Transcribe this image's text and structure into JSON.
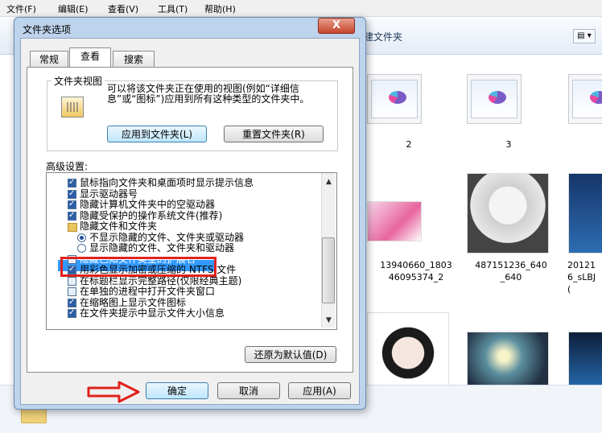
{
  "explorer": {
    "menu": [
      "文件(F)",
      "编辑(E)",
      "查看(V)",
      "工具(T)",
      "帮助(H)"
    ],
    "folder_title": "建文件夹",
    "view_toggle": "▤ ▾",
    "thumbnails": [
      {
        "label": "2"
      },
      {
        "label": "3"
      },
      {
        "label": "13940660_1803\n46095374_2"
      },
      {
        "label": "487151236_640\n_640"
      },
      {
        "label": "20121\n6_sLBJ\n("
      }
    ]
  },
  "dialog": {
    "title": "文件夹选项",
    "close_label": "X",
    "tabs": [
      "常规",
      "查看",
      "搜索"
    ],
    "active_tab": "查看",
    "folder_views": {
      "group_title": "文件夹视图",
      "description": "可以将该文件夹正在使用的视图(例如“详细信息”或“图标”)应用到所有这种类型的文件夹中。",
      "apply_button": "应用到文件夹(L)",
      "reset_button": "重置文件夹(R)"
    },
    "advanced_label": "高级设置:",
    "settings": [
      {
        "type": "checkbox",
        "checked": true,
        "indent": 0,
        "label": "鼠标指向文件夹和桌面项时显示提示信息"
      },
      {
        "type": "checkbox",
        "checked": true,
        "indent": 0,
        "label": "显示驱动器号"
      },
      {
        "type": "checkbox",
        "checked": true,
        "indent": 0,
        "label": "隐藏计算机文件夹中的空驱动器"
      },
      {
        "type": "checkbox",
        "checked": true,
        "indent": 0,
        "label": "隐藏受保护的操作系统文件(推荐)"
      },
      {
        "type": "folder",
        "checked": false,
        "indent": 0,
        "label": "隐藏文件和文件夹"
      },
      {
        "type": "radio",
        "checked": true,
        "indent": 1,
        "label": "不显示隐藏的文件、文件夹或驱动器"
      },
      {
        "type": "radio",
        "checked": false,
        "indent": 1,
        "label": "显示隐藏的文件、文件夹和驱动器"
      },
      {
        "type": "checkbox",
        "checked": false,
        "indent": 0,
        "label": "隐藏已知文件类型的扩展名",
        "selected": true
      },
      {
        "type": "checkbox",
        "checked": true,
        "indent": 0,
        "label": "用彩色显示加密或压缩的 NTFS 文件"
      },
      {
        "type": "checkbox",
        "checked": false,
        "indent": 0,
        "label": "在标题栏显示完整路径(仅限经典主题)"
      },
      {
        "type": "checkbox",
        "checked": false,
        "indent": 0,
        "label": "在单独的进程中打开文件夹窗口"
      },
      {
        "type": "checkbox",
        "checked": true,
        "indent": 0,
        "label": "在缩略图上显示文件图标"
      },
      {
        "type": "checkbox",
        "checked": true,
        "indent": 0,
        "label": "在文件夹提示中显示文件大小信息"
      }
    ],
    "restore_button": "还原为默认值(D)",
    "ok_button": "确定",
    "cancel_button": "取消",
    "apply_button": "应用(A)"
  },
  "colors": {
    "highlight": "#3399ff",
    "annotation_red": "#e0221c"
  }
}
